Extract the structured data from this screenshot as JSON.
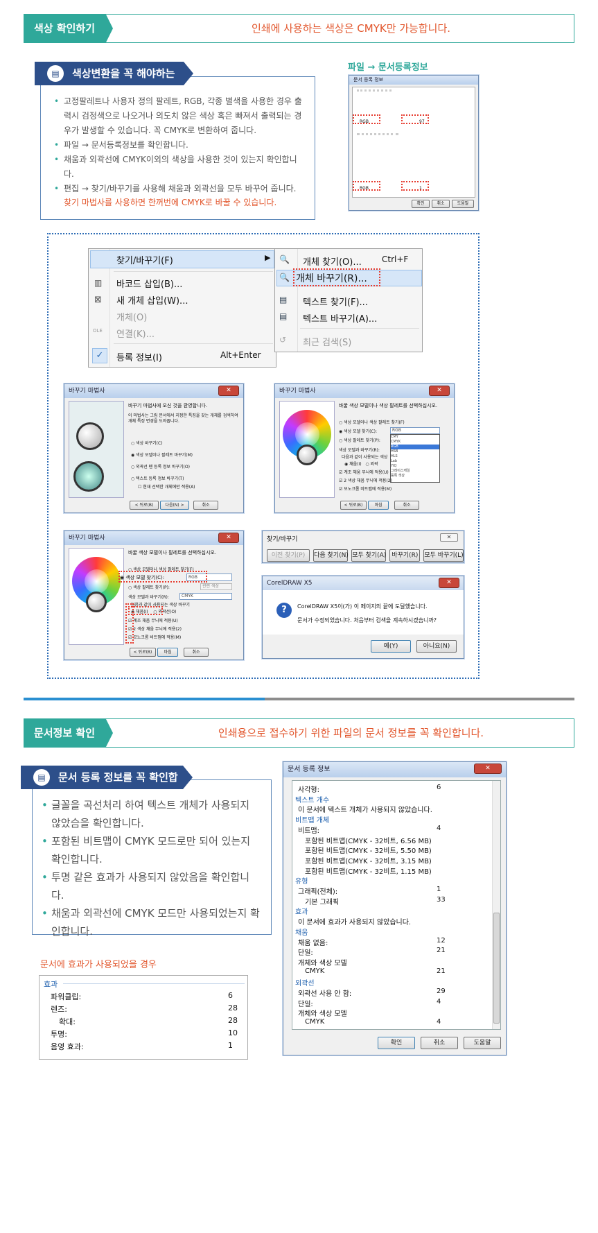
{
  "section1": {
    "tab": "색상 확인하기",
    "message": "인쇄에 사용하는 색상은 CMYK만 가능합니다.",
    "box_title": "색상변환을 꼭 해야하는 경우",
    "bullets": [
      "고정팔레트나 사용자 정의 팔레트, RGB, 각종 별색을 사용한 경우 출력시 검정색으로 나오거나 의도치 않은 색상 혹은 빠져서 출력되는 경우가 발생할 수 있습니다. 꼭 CMYK로 변환하여 줍니다.",
      "파일 → 문서등록정보를 확인합니다.",
      "채움과 외곽선에 CMYK이외의 색상을 사용한 것이 있는지 확인합니다.",
      "편집 → 찾기/바꾸기를 사용해 채움과 외곽선을 모두 바꾸어 줍니다."
    ],
    "note": "찾기 마법사를 사용하면 한꺼번에 CMYK로 바꿀 수 있습니다.",
    "caption": "파일 → 문서등록정보",
    "thumb": {
      "title": "문서 등록 정보",
      "rgb1": "RGB",
      "rgb1_val": "97",
      "rgb2": "RGB",
      "rgb2_val": "1",
      "buttons": [
        "확인",
        "취소",
        "도움말"
      ]
    }
  },
  "menu": {
    "left": [
      {
        "label": "찾기/바꾸기(F)",
        "shortcut": ""
      },
      {
        "label": "바코드 삽입(B)...",
        "shortcut": ""
      },
      {
        "label": "새 개체 삽입(W)...",
        "shortcut": ""
      },
      {
        "label": "개체(O)",
        "shortcut": ""
      },
      {
        "label": "연결(K)...",
        "shortcut": ""
      },
      {
        "label": "등록 정보(I)",
        "shortcut": "Alt+Enter"
      }
    ],
    "right": [
      {
        "label": "개체 찾기(O)...",
        "shortcut": "Ctrl+F"
      },
      {
        "label": "개체 바꾸기(R)...",
        "shortcut": ""
      },
      {
        "label": "텍스트 찾기(F)...",
        "shortcut": ""
      },
      {
        "label": "텍스트 바꾸기(A)...",
        "shortcut": ""
      },
      {
        "label": "최근 검색(S)",
        "shortcut": ""
      }
    ]
  },
  "wizard1": {
    "title": "바꾸기 마법사",
    "intro": "바꾸기 마법사에 오신 것을 환영합니다.",
    "desc": "이 마법사는 그림 문서에서 지정한 특징을 갖는 개체를 검색하여 개체 특징 변경을 도와줍니다.",
    "options": [
      "색상 바꾸기(C)",
      "색상 모델이나 팔레트 바꾸기(M)",
      "외곽선 펜 등록 정보 바꾸기(O)",
      "텍스트 등록 정보 바꾸기(T)"
    ],
    "checkbox": "현재 선택한 개체에만 적용(A)",
    "buttons": [
      "< 뒤로(B)",
      "다음(N) >",
      "취소"
    ]
  },
  "wizard2": {
    "title": "바꾸기 마법사",
    "intro": "바꿀 색상 모델이나 색상 팔레트를 선택하십시오.",
    "options": [
      "색상 모델이나 색상 팔레트 찾기(F)",
      "색상 모델 찾기(C):",
      "색상 팔레트 찾기(P):"
    ],
    "select_value": "RGB",
    "dropdown": [
      "CMY",
      "CMYK",
      "RGB",
      "HSB",
      "HLS",
      "Lab",
      "YIQ",
      "그레이스케일",
      "등록 색상"
    ],
    "replace_label": "색상 모델과 바꾸기(R):",
    "apply_label": "다음과 같이 사용되는 색상",
    "apply_opts": [
      "채움(I)",
      "외곽"
    ],
    "checks": [
      "계조 채움 무늬에 적용(U)",
      "2 색상 채움 무늬에 적용(2)",
      "모노크롬 비트맵에 적용(M)"
    ],
    "buttons": [
      "< 뒤로(B)",
      "마침",
      "취소"
    ]
  },
  "wizard3": {
    "title": "바꾸기 마법사",
    "intro": "바꿀 색상 모델이나 팔레트를 선택하십시오.",
    "options": [
      "색상 모델이나 색상 팔레트 찾기(F)",
      "색상 모델 찾기(C):",
      "색상 팔레트 찾기(P):"
    ],
    "select_value": "RGB",
    "palette_value": "관련 색상",
    "replace_label": "색상 모델과 바꾸기(R):",
    "replace_value": "CMYK",
    "apply_label": "다음과 같이 사용되는 색상 바꾸기",
    "apply_opts": [
      "채움(I)",
      "외곽선(O)"
    ],
    "checks": [
      "계조 채움 무늬에 적용(U)",
      "2 색상 채움 무늬에 적용(2)",
      "모노크롬 비트맵에 적용(M)"
    ],
    "buttons": [
      "< 뒤로(B)",
      "마침",
      "취소"
    ]
  },
  "findbar": {
    "title": "찾기/바꾸기",
    "buttons": [
      "이전 찾기(P)",
      "다음 찾기(N)",
      "모두 찾기(A)",
      "바꾸기(R)",
      "모두 바꾸기(L)"
    ]
  },
  "coreldlg": {
    "title": "CorelDRAW X5",
    "line1": "CorelDRAW X5이(가) 이 페이지의 끝에 도달했습니다.",
    "line2": "문서가 수정되었습니다. 처음부터 검색을 계속하시겠습니까?",
    "yes": "예(Y)",
    "no": "아니요(N)"
  },
  "section2": {
    "tab": "문서정보 확인",
    "message": "인쇄용으로 접수하기 위한 파일의 문서 정보를 꼭 확인합니다.",
    "box_title": "문서 등록 정보를 꼭 확인합니다.",
    "bullets": [
      "글꼴을 곡선처리 하여 텍스트 개체가 사용되지 않았슴을 확인합니다.",
      "포함된 비트맵이 CMYK 모드로만 되어 있는지 확인합니다.",
      "투명 같은 효과가 사용되지 않았음을 확인합니다.",
      "채움과 외곽선에 CMYK 모드만 사용되었는지 확인합니다."
    ],
    "effects_caption": "문서에 효과가 사용되었을 경우",
    "effects_table": {
      "header": "효과",
      "rows": [
        {
          "label": "파워클립:",
          "value": "6"
        },
        {
          "label": "렌즈:",
          "value": "28"
        },
        {
          "label": "확대:",
          "value": "28"
        },
        {
          "label": "투명:",
          "value": "10"
        },
        {
          "label": "음영 효과:",
          "value": "1"
        }
      ]
    },
    "docinfo": {
      "title": "문서 등록 정보",
      "rows": [
        {
          "label": "사각형:",
          "value": "6",
          "kind": "item"
        },
        {
          "label": "텍스트 개수",
          "value": "",
          "kind": "head"
        },
        {
          "label": "이 문서에 텍스트 개체가 사용되지 않았습니다.",
          "value": "",
          "kind": "item"
        },
        {
          "label": "비트맵 개체",
          "value": "",
          "kind": "head"
        },
        {
          "label": "비트맵:",
          "value": "4",
          "kind": "item"
        },
        {
          "label": "포함된 비트맵(CMYK - 32비트, 6.56 MB)",
          "value": "",
          "kind": "sub"
        },
        {
          "label": "포함된 비트맵(CMYK - 32비트, 5.50 MB)",
          "value": "",
          "kind": "sub"
        },
        {
          "label": "포함된 비트맵(CMYK - 32비트, 3.15 MB)",
          "value": "",
          "kind": "sub"
        },
        {
          "label": "포함된 비트맵(CMYK - 32비트, 1.15 MB)",
          "value": "",
          "kind": "sub"
        },
        {
          "label": "유형",
          "value": "",
          "kind": "head"
        },
        {
          "label": "그래픽(전체):",
          "value": "1",
          "kind": "item"
        },
        {
          "label": "기본 그래픽",
          "value": "33",
          "kind": "sub"
        },
        {
          "label": "효과",
          "value": "",
          "kind": "head"
        },
        {
          "label": "이 문서에 효과가 사용되지 않았습니다.",
          "value": "",
          "kind": "item"
        },
        {
          "label": "채움",
          "value": "",
          "kind": "head"
        },
        {
          "label": "채움 없음:",
          "value": "12",
          "kind": "item"
        },
        {
          "label": "단일:",
          "value": "21",
          "kind": "item"
        },
        {
          "label": "개체와 색상 모델",
          "value": "",
          "kind": "item"
        },
        {
          "label": "CMYK",
          "value": "21",
          "kind": "sub"
        },
        {
          "label": "외곽선",
          "value": "",
          "kind": "head"
        },
        {
          "label": "외곽선 사용 안 함:",
          "value": "29",
          "kind": "item"
        },
        {
          "label": "단일:",
          "value": "4",
          "kind": "item"
        },
        {
          "label": "개체와 색상 모델",
          "value": "",
          "kind": "item"
        },
        {
          "label": "CMYK",
          "value": "4",
          "kind": "sub"
        }
      ],
      "buttons": [
        "확인",
        "취소",
        "도움말"
      ]
    }
  }
}
